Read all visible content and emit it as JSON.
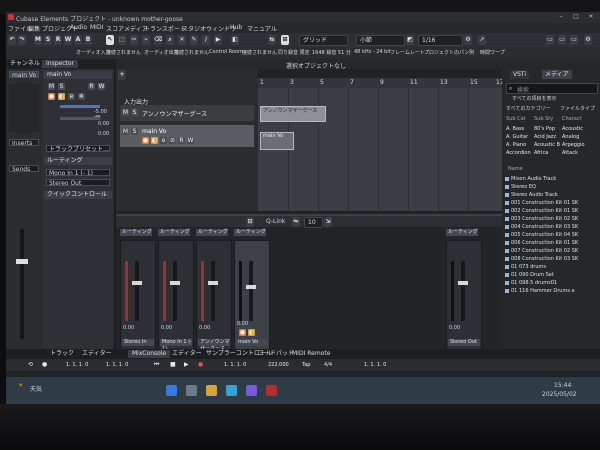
{
  "titlebar": {
    "title": "Cubase Elements プロジェクト - unknown mother-goose"
  },
  "menu": [
    "ファイル",
    "編集",
    "プロジェクト",
    "Audio",
    "MIDI",
    "スコア",
    "メディア",
    "トランスポート",
    "スタジオ",
    "ウィンドウ",
    "Hub",
    "マニュアル"
  ],
  "toolbar": {
    "mode_buttons": [
      "M",
      "S",
      "R",
      "W",
      "A",
      "B"
    ],
    "grid_label": "グリッド",
    "bar_label": "小節",
    "quantize": "1/16"
  },
  "toolbar2": {
    "items": [
      "オーディオ入力",
      "接続されません",
      "オーディオ出力",
      "接続されません",
      "Control Room",
      "接続されません",
      "同り録音 限定",
      "1648 録音 51 分",
      "48 kHz - 24 bit",
      "フレームレート",
      "プロジェクトのパン則",
      "時間ワープ"
    ]
  },
  "infobar": {
    "text": "選択オブジェクトなし"
  },
  "left_tabs": [
    "チャンネル",
    "Inspector"
  ],
  "channel_panel": {
    "track_name": "main Vo",
    "insert_label": "Inserts",
    "send_label": "Sends"
  },
  "inspector": {
    "track_name": "main Vo",
    "buttons": [
      "M",
      "S",
      "R",
      "W"
    ],
    "volume": "-5.00 dB",
    "pan": "0.00",
    "delay": "0.00",
    "track_preset": "トラックプリセット...",
    "routing": "ルーティング",
    "input": "Mono In 1 (- 1)",
    "output": "Stereo Out",
    "quick_controls": "クイックコントロール"
  },
  "tracklist": {
    "folder": "入力出力",
    "track1": {
      "name": "アンノウンマザーグース"
    },
    "track2": {
      "name": "main Vo"
    },
    "track_buttons": [
      "M",
      "S",
      "R",
      "W"
    ]
  },
  "ruler": {
    "marks": [
      "1",
      "3",
      "5",
      "7",
      "9",
      "11",
      "13",
      "15",
      "17"
    ]
  },
  "clips": [
    {
      "label": "アンノウンマザーグース"
    },
    {
      "label": "main Vo"
    }
  ],
  "right_zone": {
    "tabs": [
      "VSTi",
      "メディア"
    ],
    "search_placeholder": "検索",
    "filter": "すべての項目を表示",
    "filter2": "すべてのカテゴリー",
    "filter3": "ファイルタイプ",
    "headers": [
      "Sub Cat",
      "Sub Sty",
      "Charact"
    ],
    "col1": [
      "A. Bass",
      "A. Guitar",
      "A. Piano",
      "Accordion"
    ],
    "col2": [
      "80's Pop",
      "Acid Jazz",
      "Acoustic B",
      "Africa"
    ],
    "col3": [
      "Acoustic",
      "Analog",
      "Arpeggio",
      "Attack"
    ],
    "name_header": "Name",
    "results": [
      "Mixon Audio Track",
      "Stereo EQ",
      "Stereo Audio Track",
      "001 Construction Kit 01 SK",
      "002 Construction Kit 01 SK",
      "003 Construction Kit 02 SK",
      "004 Construction Kit 03 SK",
      "005 Construction Kit 04 SK",
      "006 Construction Kit 01 SK",
      "007 Construction Kit 02 SK",
      "008 Construction Kit 03 SK",
      "01 073 drums",
      "01 090 Drum Set",
      "01 098.5 drums01",
      "01 116 Hammer Drums a"
    ]
  },
  "lower_zone": {
    "header": {
      "link": "Q-Link",
      "value": "10"
    },
    "routing": "ルーティング",
    "strips": [
      {
        "name": "Stereo In",
        "value": "0.00"
      },
      {
        "name": "Mono In 1 (- 1)",
        "value": "0.00"
      },
      {
        "name": "アンノウンマザーグース",
        "value": "0.00"
      },
      {
        "name": "main Vo",
        "value": "0.00"
      }
    ],
    "master": {
      "name": "Stereo Out",
      "value": "0.00"
    }
  },
  "bottom_tabs": [
    "トラック",
    "エディター",
    "MixConsole",
    "エディター",
    "サンプラーコントロール",
    "コードパッド",
    "MIDI Remote"
  ],
  "transport": {
    "pos_left": "1. 1. 1. 0",
    "pos_right": "1. 1. 1. 0",
    "pos_main": "1. 1. 1. 0",
    "tempo": "222.000",
    "mode": "Tap",
    "meter": "4/4",
    "pos_end": "1. 1. 1. 0"
  },
  "taskbar": {
    "weather": "天気",
    "time": "15:44",
    "date": "2025/05/02"
  },
  "colors": {
    "accent": "#e07a3a",
    "bg": "#202226",
    "clip": "#8d9094",
    "selected": "#3d4046"
  }
}
